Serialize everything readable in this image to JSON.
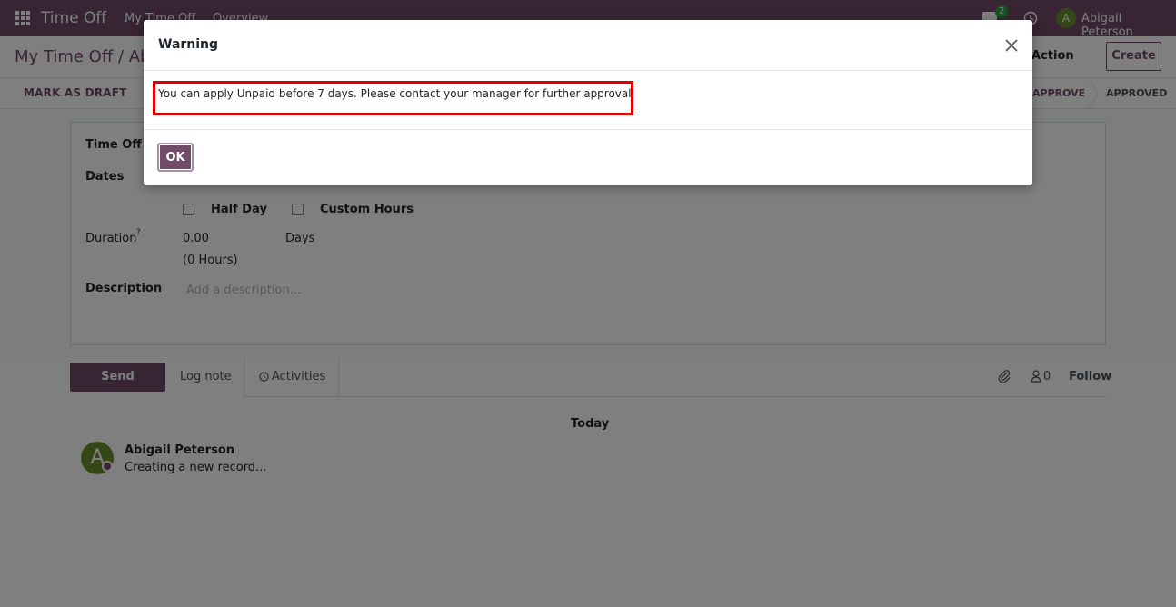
{
  "navbar": {
    "brand": "Time Off",
    "menu": [
      "My Time Off",
      "Overview"
    ],
    "chat_count": "2",
    "user_initial": "A",
    "user_name": "Abigail Peterson",
    "color": "#714b67"
  },
  "control_panel": {
    "breadcrumb": "My Time Off / Abi",
    "action_label": "Action",
    "create_label": "Create"
  },
  "status_bar": {
    "draft_label": "MARK AS DRAFT",
    "stages": [
      "APPROVE",
      "APPROVED"
    ]
  },
  "form": {
    "type_label": "Time Off T",
    "dates_label": "Dates",
    "half_day_label": "Half Day",
    "custom_hours_label": "Custom Hours",
    "duration_label": "Duration",
    "duration_help": "?",
    "duration_value": "0.00",
    "duration_unit": "Days",
    "duration_hours": "(0 Hours)",
    "description_label": "Description",
    "description_placeholder": "Add a description..."
  },
  "chatter": {
    "send_message": "Send message",
    "log_note": "Log note",
    "activities": "Activities",
    "follower_count": "0",
    "follow": "Follow",
    "date_separator": "Today",
    "message": {
      "author_initial": "A",
      "author": "Abigail Peterson",
      "body": "Creating a new record..."
    }
  },
  "dialog": {
    "title": "Warning",
    "message": "You can apply Unpaid before 7 days. Please contact your manager for further approval.",
    "ok_label": "OK",
    "highlight_color": "#e00000"
  }
}
